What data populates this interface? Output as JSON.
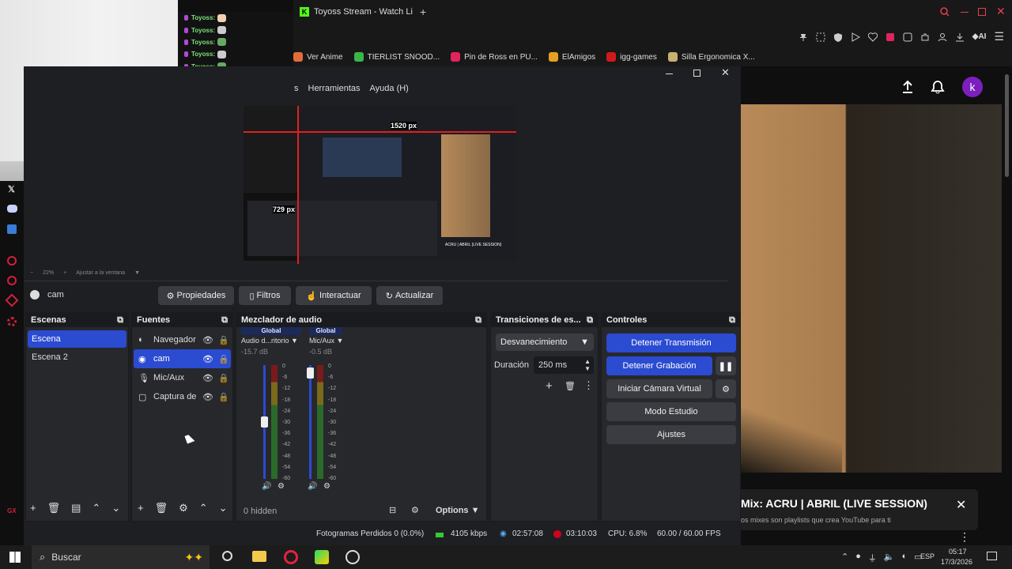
{
  "chat": {
    "username": "Toyoss:",
    "messages": [
      "Toyoss:",
      "Toyoss:",
      "Toyoss:",
      "Toyoss:",
      "Toyoss:",
      "Toyoss:",
      "Toyoss:",
      "Toyoss:",
      "Toyoss:"
    ]
  },
  "browser": {
    "tab_title": "Toyoss Stream - Watch Li",
    "new_tab": "+",
    "ai_label": "AI",
    "bookmarks": [
      "Ver Anime",
      "TIERLIST SNOOD...",
      "Pin de Ross en PU...",
      "ElAmigos",
      "igg-games",
      "Silla Ergonomica X..."
    ]
  },
  "obs": {
    "menu": [
      "s",
      "Herramientas",
      "Ayuda (H)"
    ],
    "preview": {
      "overlay_1": "1520 px",
      "overlay_2": "729 px",
      "mini_title": "ACRU | ABRIL (LIVE SESSION)"
    },
    "zoom": {
      "percent": "22%",
      "fit_label": "Ajustar a la ventana"
    },
    "context": {
      "source_name": "cam",
      "properties": "Propiedades",
      "filters": "Filtros",
      "interact": "Interactuar",
      "refresh": "Actualizar"
    },
    "scenes": {
      "title": "Escenas",
      "items": [
        "Escena",
        "Escena 2"
      ]
    },
    "sources": {
      "title": "Fuentes",
      "items": [
        "Navegador",
        "cam",
        "Mic/Aux",
        "Captura de"
      ]
    },
    "mixer": {
      "title": "Mezclador de audio",
      "channels": [
        {
          "tag": "Global",
          "name": "Audio d...ritorio",
          "db": "-15.7 dB",
          "level": 0.55
        },
        {
          "tag": "Global",
          "name": "Mic/Aux",
          "db": "-0.5 dB",
          "level": 0.98
        }
      ],
      "scale": [
        "0",
        "-6",
        "-12",
        "-18",
        "-24",
        "-30",
        "-36",
        "-42",
        "-48",
        "-54",
        "-60"
      ],
      "hidden": "0 hidden",
      "options": "Options"
    },
    "transitions": {
      "title": "Transiciones de es...",
      "selected": "Desvanecimiento",
      "duration_label": "Duración",
      "duration_value": "250 ms"
    },
    "controls": {
      "title": "Controles",
      "stop_stream": "Detener Transmisión",
      "stop_record": "Detener Grabación",
      "virtual_cam": "Iniciar Cámara Virtual",
      "studio_mode": "Modo Estudio",
      "settings": "Ajustes"
    },
    "status": {
      "dropped": "Fotogramas Perdidos 0 (0.0%)",
      "bitrate": "4105 kbps",
      "stream_time": "02:57:08",
      "record_time": "03:10:03",
      "cpu": "CPU: 6.8%",
      "fps": "60.00 / 60.00 FPS"
    }
  },
  "youtube": {
    "avatar_letter": "k",
    "mix_title": "Mix: ACRU | ABRIL (LIVE SESSION)",
    "mix_sub": "os mixes son playlists que crea YouTube para ti"
  },
  "taskbar": {
    "search": "Buscar",
    "lang": "ESP",
    "time": "05:17",
    "date": "17/3/2026"
  },
  "colors": {
    "accent": "#2b4bd1",
    "record": "#d0021b",
    "bg": "#1e1f22"
  }
}
